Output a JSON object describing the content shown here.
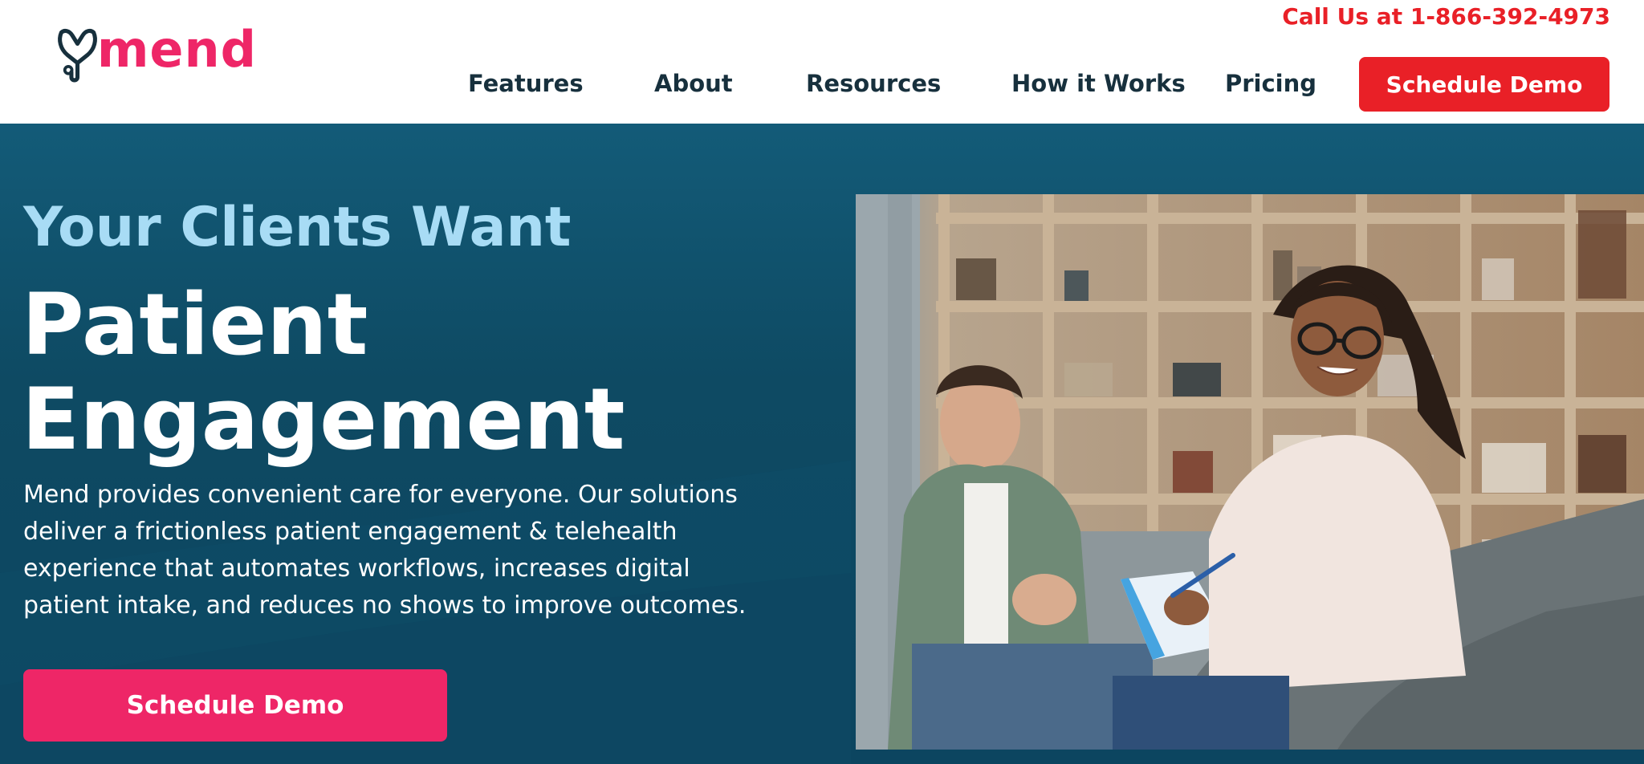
{
  "brand": {
    "name": "mend",
    "logo_icon": "stethoscope-heart-icon",
    "colors": {
      "pink": "#ee2667",
      "red": "#e92027",
      "navy": "#17303d",
      "teal": "#0e4a63",
      "light_blue": "#a8dcf5"
    }
  },
  "header": {
    "phone_text": "Call Us at 1-866-392-4973",
    "nav": [
      {
        "label": "Features",
        "has_dropdown": true
      },
      {
        "label": "About",
        "has_dropdown": true
      },
      {
        "label": "Resources",
        "has_dropdown": true
      },
      {
        "label": "How it Works",
        "has_dropdown": false
      },
      {
        "label": "Pricing",
        "has_dropdown": false
      }
    ],
    "cta_label": "Schedule Demo"
  },
  "hero": {
    "eyebrow": "Your Clients Want",
    "headline_line1": "Patient",
    "headline_line2": "Engagement",
    "body_lines": [
      "Mend provides convenient care for everyone. Our solutions",
      "deliver a frictionless patient engagement & telehealth",
      "experience that automates workflows, increases digital",
      "patient intake, and reduces no shows to improve outcomes."
    ],
    "cta_label": "Schedule Demo",
    "image": "therapy-session-photo"
  }
}
